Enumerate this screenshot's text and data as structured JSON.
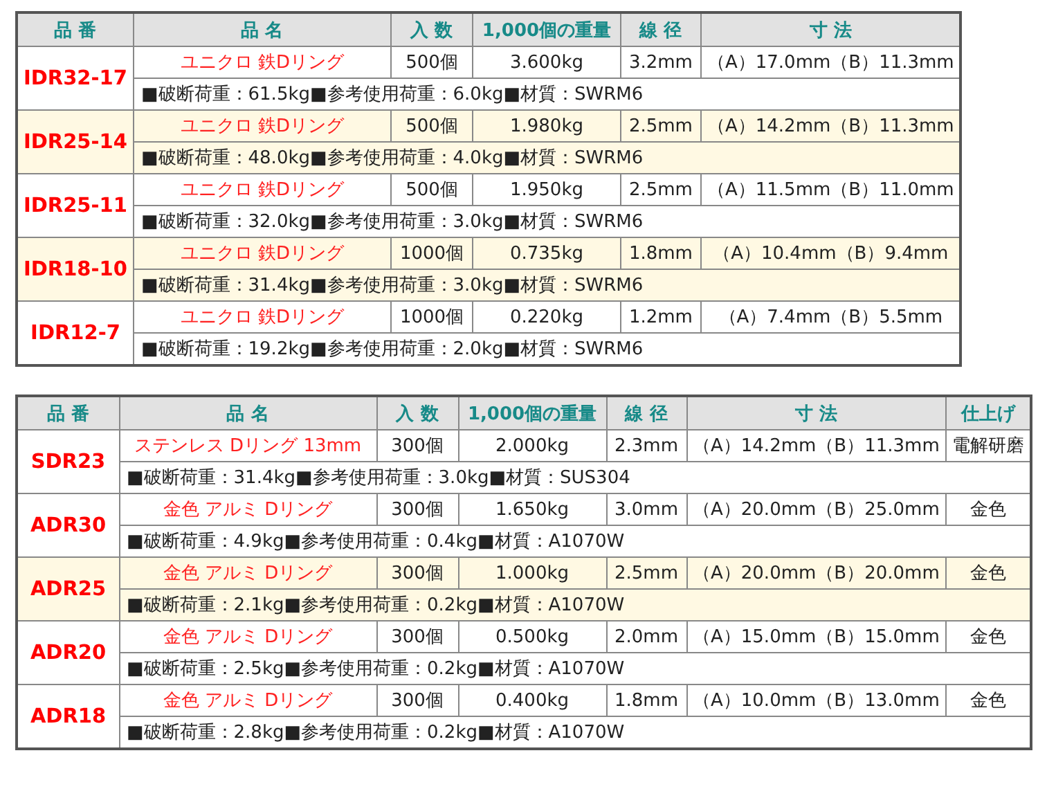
{
  "tables": [
    {
      "columns": [
        "品 番",
        "品 名",
        "入 数",
        "1,000個の重量",
        "線 径",
        "寸 法"
      ],
      "products": [
        {
          "code": "IDR32-17",
          "name": "ユニクロ 鉄Dリング",
          "quantity": "500個",
          "weight": "3.600kg",
          "wire": "3.2mm",
          "dimensions": "（A）17.0mm（B）11.3mm",
          "specs": "■破断荷重：61.5kg■参考使用荷重：6.0kg■材質：SWRM6",
          "shaded": false
        },
        {
          "code": "IDR25-14",
          "name": "ユニクロ 鉄Dリング",
          "quantity": "500個",
          "weight": "1.980kg",
          "wire": "2.5mm",
          "dimensions": "（A）14.2mm（B）11.3mm",
          "specs": "■破断荷重：48.0kg■参考使用荷重：4.0kg■材質：SWRM6",
          "shaded": true
        },
        {
          "code": "IDR25-11",
          "name": "ユニクロ 鉄Dリング",
          "quantity": "500個",
          "weight": "1.950kg",
          "wire": "2.5mm",
          "dimensions": "（A）11.5mm（B）11.0mm",
          "specs": "■破断荷重：32.0kg■参考使用荷重：3.0kg■材質：SWRM6",
          "shaded": false
        },
        {
          "code": "IDR18-10",
          "name": "ユニクロ 鉄Dリング",
          "quantity": "1000個",
          "weight": "0.735kg",
          "wire": "1.8mm",
          "dimensions": "（A）10.4mm（B）9.4mm",
          "specs": "■破断荷重：31.4kg■参考使用荷重：3.0kg■材質：SWRM6",
          "shaded": true
        },
        {
          "code": "IDR12-7",
          "name": "ユニクロ 鉄Dリング",
          "quantity": "1000個",
          "weight": "0.220kg",
          "wire": "1.2mm",
          "dimensions": "（A）7.4mm（B）5.5mm",
          "specs": "■破断荷重：19.2kg■参考使用荷重：2.0kg■材質：SWRM6",
          "shaded": false
        }
      ]
    },
    {
      "columns": [
        "品 番",
        "品 名",
        "入 数",
        "1,000個の重量",
        "線 径",
        "寸 法",
        "仕上げ"
      ],
      "products": [
        {
          "code": "SDR23",
          "name": "ステンレス Dリング 13mm",
          "quantity": "300個",
          "weight": "2.000kg",
          "wire": "2.3mm",
          "dimensions": "（A）14.2mm（B）11.3mm",
          "finish": "電解研磨",
          "specs": "■破断荷重：31.4kg■参考使用荷重：3.0kg■材質：SUS304",
          "shaded": false
        },
        {
          "code": "ADR30",
          "name": "金色 アルミ Dリング",
          "quantity": "300個",
          "weight": "1.650kg",
          "wire": "3.0mm",
          "dimensions": "（A）20.0mm（B）25.0mm",
          "finish": "金色",
          "specs": "■破断荷重：4.9kg■参考使用荷重：0.4kg■材質：A1070W",
          "shaded": false
        },
        {
          "code": "ADR25",
          "name": "金色 アルミ Dリング",
          "quantity": "300個",
          "weight": "1.000kg",
          "wire": "2.5mm",
          "dimensions": "（A）20.0mm（B）20.0mm",
          "finish": "金色",
          "specs": "■破断荷重：2.1kg■参考使用荷重：0.2kg■材質：A1070W",
          "shaded": true
        },
        {
          "code": "ADR20",
          "name": "金色 アルミ Dリング",
          "quantity": "300個",
          "weight": "0.500kg",
          "wire": "2.0mm",
          "dimensions": "（A）15.0mm（B）15.0mm",
          "finish": "金色",
          "specs": "■破断荷重：2.5kg■参考使用荷重：0.2kg■材質：A1070W",
          "shaded": false
        },
        {
          "code": "ADR18",
          "name": "金色 アルミ Dリング",
          "quantity": "300個",
          "weight": "0.400kg",
          "wire": "1.8mm",
          "dimensions": "（A）10.0mm（B）13.0mm",
          "finish": "金色",
          "specs": "■破断荷重：2.8kg■参考使用荷重：0.2kg■材質：A1070W",
          "shaded": false
        }
      ]
    }
  ]
}
